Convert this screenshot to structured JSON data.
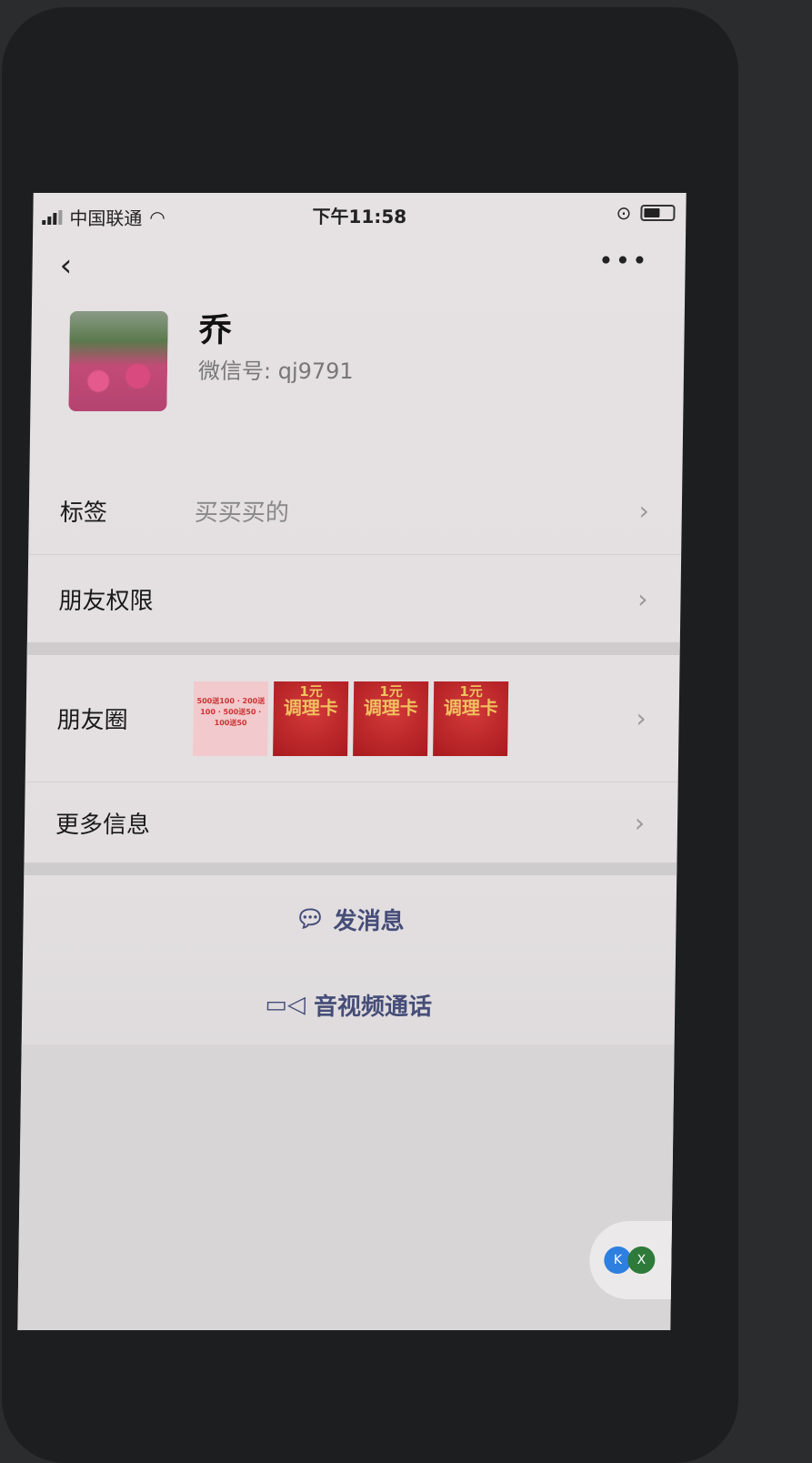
{
  "status_bar": {
    "carrier": "中国联通",
    "time": "下午11:58"
  },
  "profile": {
    "name": "乔",
    "wechat_id": "微信号: qj9791"
  },
  "rows": [
    {
      "label": "标签",
      "value": "买买买的"
    },
    {
      "label": "朋友权限",
      "value": ""
    },
    {
      "label": "朋友圈",
      "value": ""
    },
    {
      "label": "更多信息",
      "value": ""
    }
  ],
  "moments_thumbs": [
    {
      "type": "pink",
      "text": "500送100 · 200送100 · 500送50 · 100送50"
    },
    {
      "type": "red",
      "title": "1元",
      "subtitle": "调理卡"
    },
    {
      "type": "red",
      "title": "1元",
      "subtitle": "调理卡"
    },
    {
      "type": "red",
      "title": "1元",
      "subtitle": "调理卡"
    }
  ],
  "actions": {
    "message": "发消息",
    "call": "音视频通话"
  },
  "floating": {
    "a": "K",
    "b": "X"
  },
  "colors": {
    "action_text": "#454d78",
    "background": "#e6e1e3"
  }
}
